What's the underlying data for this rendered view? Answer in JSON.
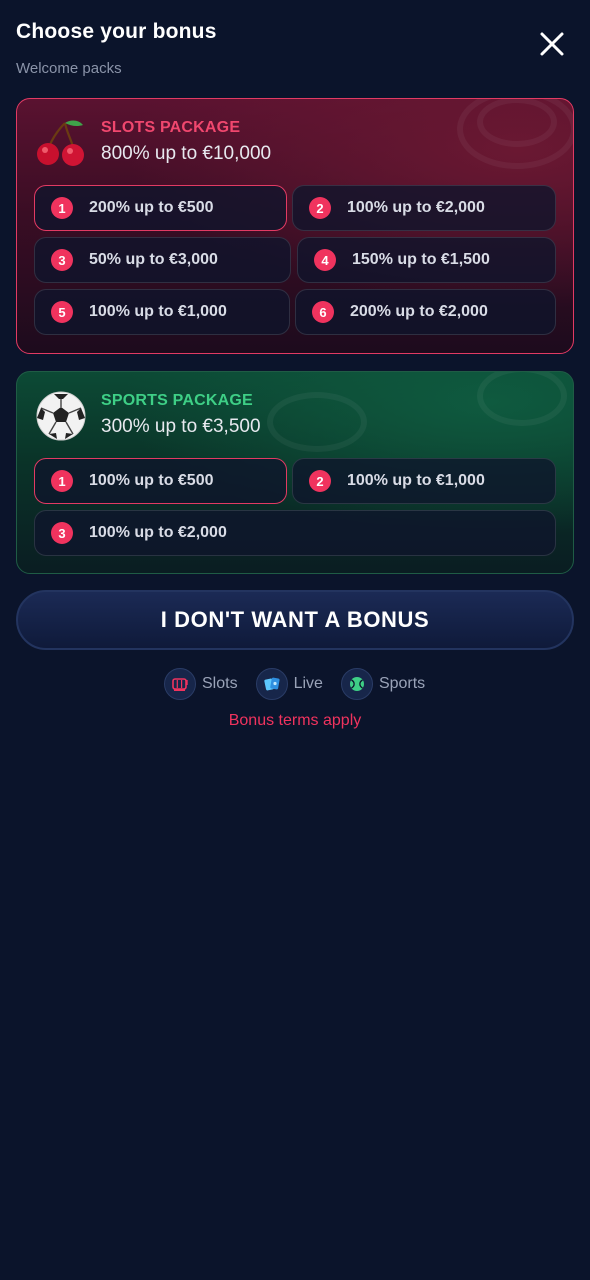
{
  "header": {
    "title": "Choose your bonus",
    "subtitle": "Welcome packs"
  },
  "slots": {
    "name": "SLOTS PACKAGE",
    "amount": "800% up to €10,000",
    "icon": "cherries-icon",
    "options": [
      {
        "num": "1",
        "label": "200% up to €500",
        "selected": true
      },
      {
        "num": "2",
        "label": "100% up to €2,000"
      },
      {
        "num": "3",
        "label": "50% up to €3,000"
      },
      {
        "num": "4",
        "label": "150% up to €1,500"
      },
      {
        "num": "5",
        "label": "100% up to €1,000"
      },
      {
        "num": "6",
        "label": "200% up to €2,000"
      }
    ]
  },
  "sports": {
    "name": "SPORTS PACKAGE",
    "amount": "300% up to €3,500",
    "icon": "soccer-ball-icon",
    "options": [
      {
        "num": "1",
        "label": "100% up to €500",
        "selected": true
      },
      {
        "num": "2",
        "label": "100% up to €1,000"
      },
      {
        "num": "3",
        "label": "100% up to €2,000"
      }
    ]
  },
  "no_bonus_label": "I DON'T WANT A BONUS",
  "categories": [
    {
      "label": "Slots",
      "icon": "slot-machine-icon"
    },
    {
      "label": "Live",
      "icon": "live-cards-icon"
    },
    {
      "label": "Sports",
      "icon": "tennis-ball-icon"
    }
  ],
  "terms_label": "Bonus terms apply",
  "colors": {
    "background": "#0b142b",
    "accent_red": "#f0335e",
    "accent_green": "#3ecf86"
  }
}
